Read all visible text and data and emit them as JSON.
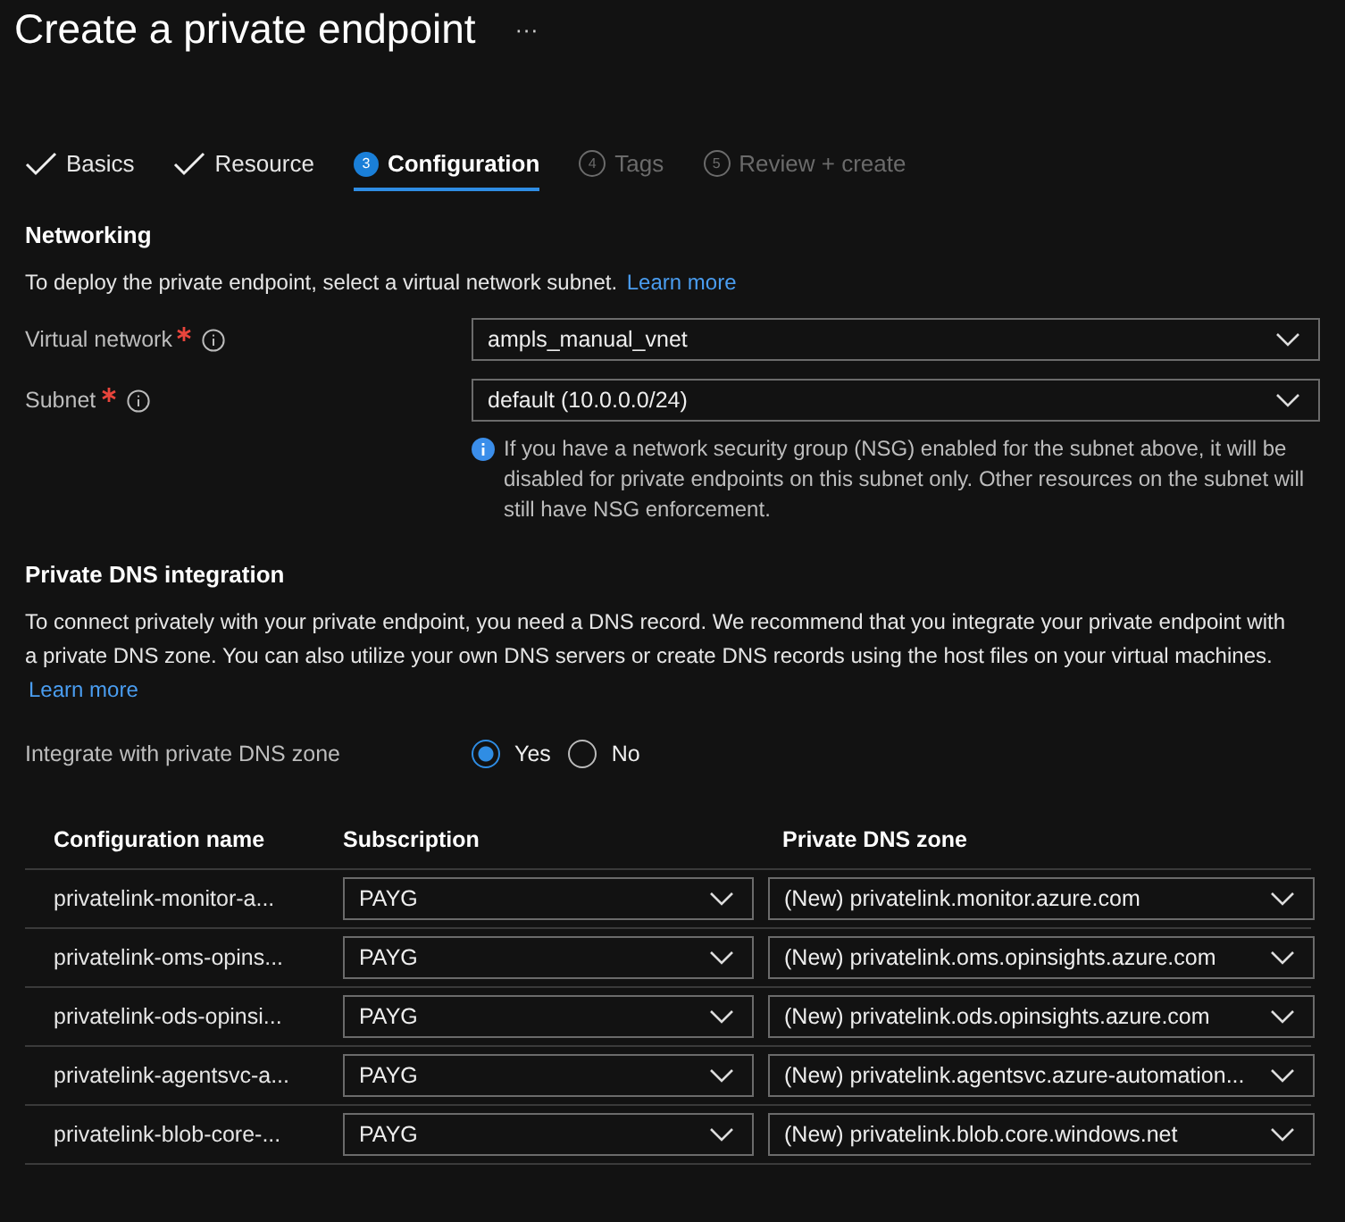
{
  "page": {
    "title": "Create a private endpoint",
    "more": "···"
  },
  "tabs": [
    {
      "label": "Basics",
      "kind": "done",
      "selected": false
    },
    {
      "label": "Resource",
      "kind": "done",
      "selected": false
    },
    {
      "label": "Configuration",
      "kind": "current",
      "number": "3",
      "selected": true
    },
    {
      "label": "Tags",
      "kind": "pending",
      "number": "4",
      "selected": false
    },
    {
      "label": "Review + create",
      "kind": "pending",
      "number": "5",
      "selected": false
    }
  ],
  "networking": {
    "heading": "Networking",
    "description": "To deploy the private endpoint, select a virtual network subnet.",
    "link": "Learn more",
    "fields": [
      {
        "label": "Virtual network",
        "required": true,
        "value": "ampls_manual_vnet"
      },
      {
        "label": "Subnet",
        "required": true,
        "value": "default (10.0.0.0/24)",
        "note": "If you have a network security group (NSG) enabled for the subnet above, it will be disabled for private endpoints on this subnet only. Other resources on the subnet will still have NSG enforcement."
      }
    ]
  },
  "dns": {
    "heading": "Private DNS integration",
    "description": "To connect privately with your private endpoint, you need a DNS record. We recommend that you integrate your private endpoint with a private DNS zone. You can also utilize your own DNS servers or create DNS records using the host files on your virtual machines.",
    "link": "Learn more",
    "integrate": {
      "label": "Integrate with private DNS zone",
      "options": [
        {
          "label": "Yes",
          "selected": true
        },
        {
          "label": "No",
          "selected": false
        }
      ]
    },
    "table": {
      "columns": [
        "Configuration name",
        "Subscription",
        "Private DNS zone"
      ],
      "rows": [
        {
          "name": "privatelink-monitor-a...",
          "subscription": "PAYG",
          "zone": "(New) privatelink.monitor.azure.com"
        },
        {
          "name": "privatelink-oms-opins...",
          "subscription": "PAYG",
          "zone": "(New) privatelink.oms.opinsights.azure.com"
        },
        {
          "name": "privatelink-ods-opinsi...",
          "subscription": "PAYG",
          "zone": "(New) privatelink.ods.opinsights.azure.com"
        },
        {
          "name": "privatelink-agentsvc-a...",
          "subscription": "PAYG",
          "zone": "(New) privatelink.agentsvc.azure-automation..."
        },
        {
          "name": "privatelink-blob-core-...",
          "subscription": "PAYG",
          "zone": "(New) privatelink.blob.core.windows.net"
        }
      ]
    }
  }
}
